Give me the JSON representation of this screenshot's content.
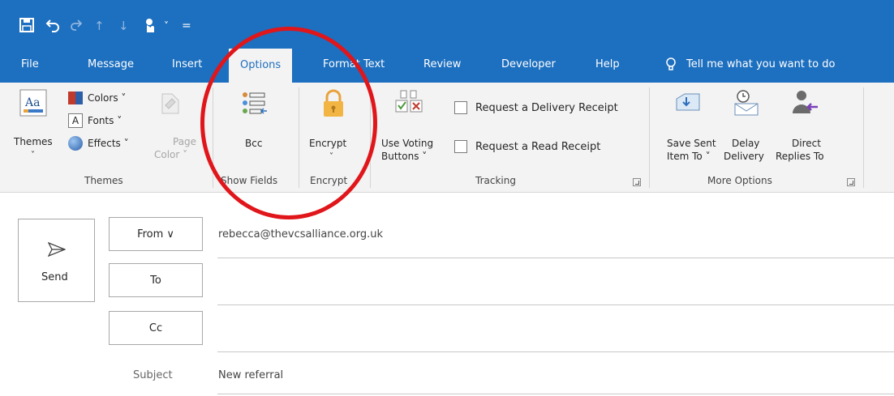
{
  "quick_access": {
    "save_icon": "save-icon",
    "undo_icon": "undo-icon",
    "redo_icon": "redo-icon",
    "up_icon": "arrow-up-icon",
    "down_icon": "arrow-down-icon",
    "touch_icon": "touch-mode-icon",
    "customize_icon": "customize-icon"
  },
  "tabs": [
    {
      "label": "File"
    },
    {
      "label": "Message"
    },
    {
      "label": "Insert"
    },
    {
      "label": "Options"
    },
    {
      "label": "Format Text"
    },
    {
      "label": "Review"
    },
    {
      "label": "Developer"
    },
    {
      "label": "Help"
    }
  ],
  "tell_me": "Tell me what you want to do",
  "ribbon": {
    "themes": {
      "themes_label": "Themes",
      "colors_label": "Colors ˅",
      "fonts_label": "Fonts ˅",
      "effects_label": "Effects ˅",
      "page_label": "Page",
      "color_label": "Color ˅",
      "group_label": "Themes"
    },
    "show_fields": {
      "bcc_label": "Bcc",
      "group_label": "Show Fields"
    },
    "encrypt": {
      "encrypt_label": "Encrypt",
      "group_label": "Encrypt"
    },
    "tracking": {
      "use_voting_line1": "Use Voting",
      "use_voting_line2": "Buttons ˅",
      "delivery_receipt": "Request a Delivery Receipt",
      "read_receipt": "Request a Read Receipt",
      "group_label": "Tracking"
    },
    "more_options": {
      "save_sent_line1": "Save Sent",
      "save_sent_line2": "Item To ˅",
      "delay_line1": "Delay",
      "delay_line2": "Delivery",
      "direct_line1": "Direct",
      "direct_line2": "Replies To",
      "group_label": "More Options"
    }
  },
  "compose": {
    "send_label": "Send",
    "from_label": "From ∨",
    "to_label": "To",
    "cc_label": "Cc",
    "subject_label": "Subject",
    "from_value": "rebecca@thevcsalliance.org.uk",
    "subject_value": "New referral"
  },
  "colors": {
    "accent": "#1d6fbf",
    "annotation": "#e0161b"
  }
}
